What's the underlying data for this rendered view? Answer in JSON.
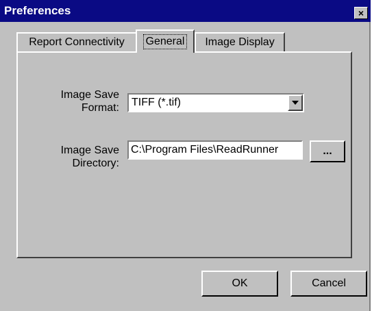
{
  "window": {
    "title": "Preferences",
    "close_glyph": "×"
  },
  "tabs": [
    {
      "label": "Report Connectivity",
      "active": false
    },
    {
      "label": "General",
      "active": true
    },
    {
      "label": "Image Display",
      "active": false
    }
  ],
  "general": {
    "format_label": "Image Save\nFormat:",
    "format_value": "TIFF (*.tif)",
    "directory_label": "Image Save\nDirectory:",
    "directory_value": "C:\\Program Files\\ReadRunner",
    "browse_label": "..."
  },
  "buttons": {
    "ok_label": "OK",
    "cancel_label": "Cancel"
  },
  "colors": {
    "titlebar": "#0a0a84",
    "face": "#c0c0c0"
  },
  "icons": [
    "close-icon",
    "dropdown-arrow-icon"
  ]
}
